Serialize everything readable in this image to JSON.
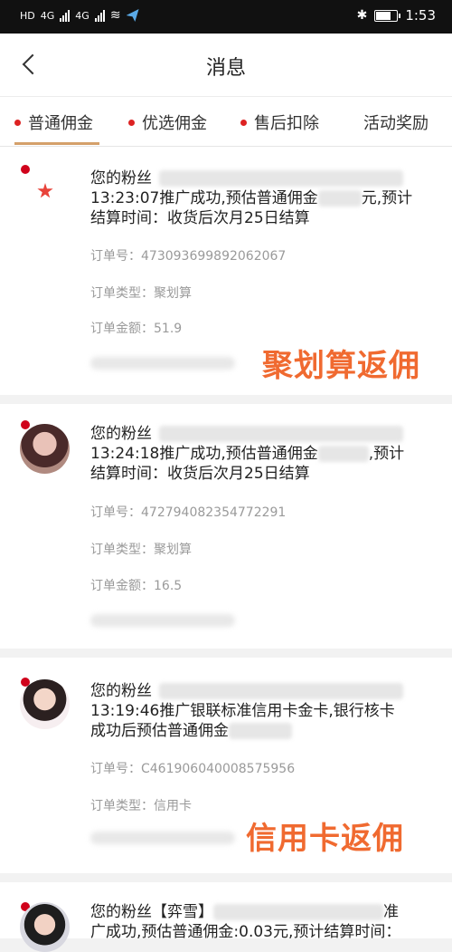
{
  "statusbar": {
    "left_labels": [
      "HD",
      "4G",
      "4G"
    ],
    "time": "1:53"
  },
  "header": {
    "title": "消息"
  },
  "tabs": [
    {
      "label": "普通佣金",
      "dot": true,
      "active": true
    },
    {
      "label": "优选佣金",
      "dot": true,
      "active": false
    },
    {
      "label": "售后扣除",
      "dot": true,
      "active": false
    },
    {
      "label": "活动奖励",
      "dot": false,
      "active": false
    }
  ],
  "cards": [
    {
      "line1_prefix": "您的粉丝",
      "line2": "13:23:07推广成功,预估普通佣金",
      "line2_suffix": "元,预计",
      "line3": "结算时间：收货后次月25日结算",
      "order_no": "订单号：473093699892062067",
      "order_type": "订单类型：聚划算",
      "order_amount": "订单金额：51.9",
      "overlay": "聚划算返佣"
    },
    {
      "line1_prefix": "您的粉丝",
      "line2": "13:24:18推广成功,预估普通佣金",
      "line2_suffix": ",预计",
      "line3": "结算时间：收货后次月25日结算",
      "order_no": "订单号：472794082354772291",
      "order_type": "订单类型：聚划算",
      "order_amount": "订单金额：16.5"
    },
    {
      "line1_prefix": "您的粉丝",
      "line2": "13:19:46推广银联标准信用卡金卡,银行核卡",
      "line3": "成功后预估普通佣金",
      "order_no": "订单号：C461906040008575956",
      "order_type": "订单类型：信用卡",
      "overlay": "信用卡返佣"
    },
    {
      "line1_prefix": "您的粉丝【弈雪】",
      "line1_suffix": "准",
      "line2": "广成功,预估普通佣金:0.03元,预计结算时间："
    }
  ]
}
